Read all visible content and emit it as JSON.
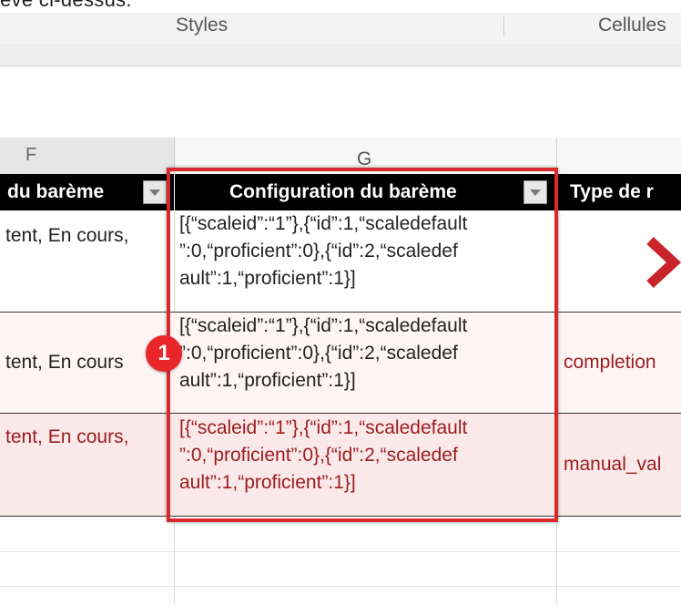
{
  "caption": {
    "text": "ève ci-dessus."
  },
  "ribbon": {
    "groups": [
      "Styles",
      "Cellules"
    ]
  },
  "column_headers": [
    "F",
    "G"
  ],
  "table": {
    "headers": [
      "du barème",
      "Configuration du barème",
      "Type de r"
    ],
    "rows": [
      {
        "col_f": "tent, En cours,",
        "config": [
          "[{“scaleid”:“1”},{“id”:1,“scaledefault",
          "”:0,“proficient”:0},{“id”:2,“scaledef",
          "ault”:1,“proficient”:1}]"
        ],
        "type": ""
      },
      {
        "col_f": "tent, En cours",
        "config": [
          "[{“scaleid”:“1”},{“id”:1,“scaledefault",
          "”:0,“proficient”:0},{“id”:2,“scaledef",
          "ault”:1,“proficient”:1}]"
        ],
        "type": "completion"
      },
      {
        "col_f": "tent, En cours,",
        "config": [
          "[{“scaleid”:“1”},{“id”:1,“scaledefault",
          "”:0,“proficient”:0},{“id”:2,“scaledef",
          "ault”:1,“proficient”:1}]"
        ],
        "type": "manual_val"
      }
    ]
  },
  "callout": {
    "number": "1"
  },
  "colors": {
    "accent_red": "#d7282c",
    "row_text_red": "#9b1b1e",
    "header_bg": "#000000"
  },
  "icons": [
    "dropdown-arrow-icon",
    "chevron-right-icon"
  ]
}
